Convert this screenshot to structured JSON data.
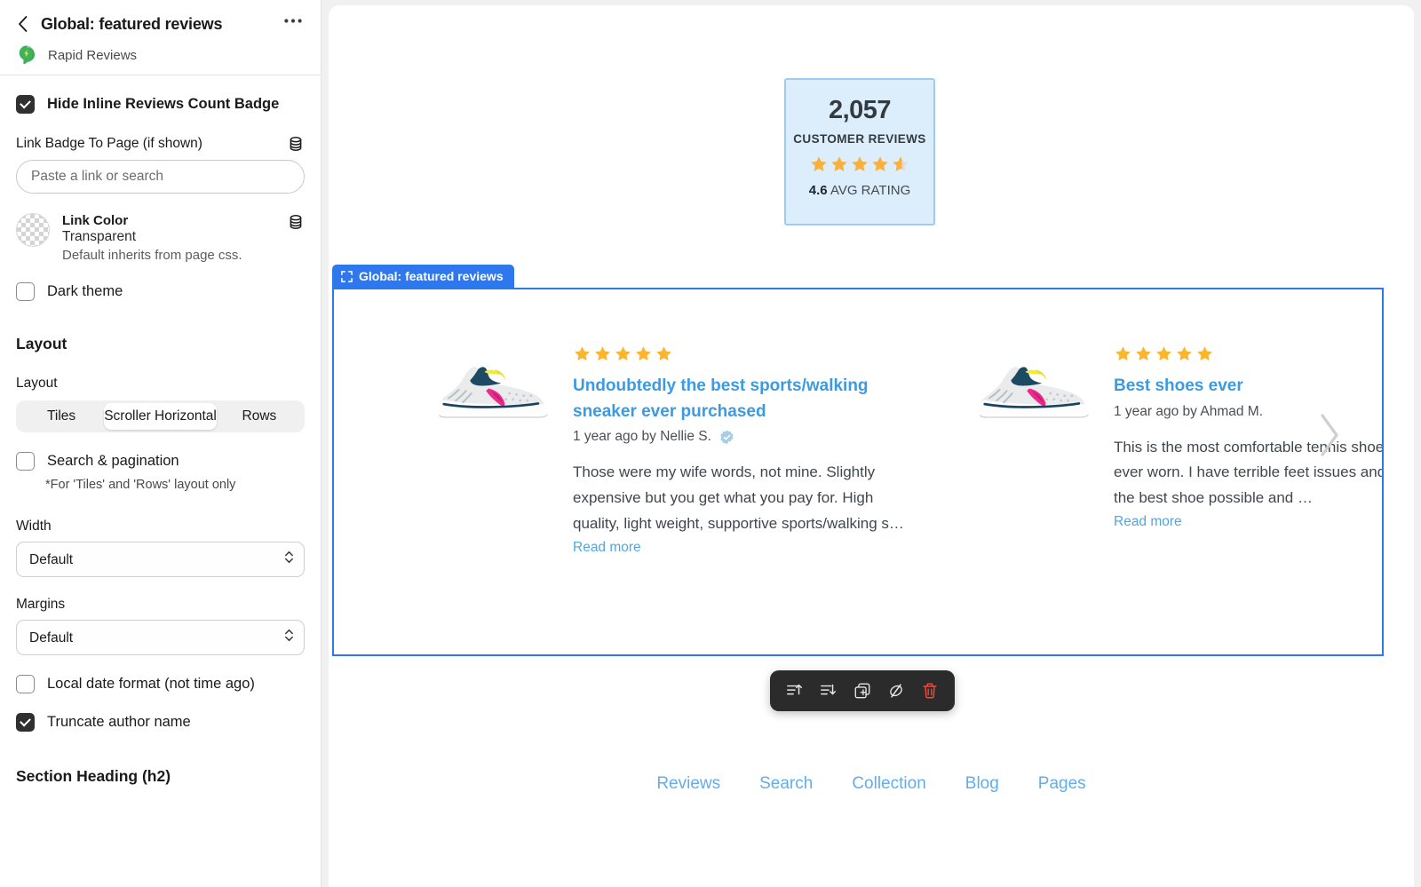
{
  "sidebar": {
    "back_icon": "chevron-left-icon",
    "title": "Global: featured reviews",
    "more_icon": "ellipsis-icon",
    "app_name": "Rapid Reviews",
    "hide_badge": {
      "label": "Hide Inline Reviews Count Badge",
      "checked": true
    },
    "link_badge": {
      "label": "Link Badge To Page (if shown)",
      "placeholder": "Paste a link or search",
      "value": "",
      "db_icon": "database-icon"
    },
    "link_color": {
      "name": "Link Color",
      "value": "Transparent",
      "hint": "Default inherits from page css.",
      "db_icon": "database-icon"
    },
    "dark_theme": {
      "label": "Dark theme",
      "checked": false
    },
    "layout_section_heading": "Layout",
    "layout_field_label": "Layout",
    "layout_options": [
      "Tiles",
      "Scroller Horizontal",
      "Rows"
    ],
    "layout_selected": "Scroller Horizontal",
    "search_pagination": {
      "label": "Search & pagination",
      "checked": false,
      "hint": "*For 'Tiles' and 'Rows' layout only"
    },
    "width": {
      "label": "Width",
      "value": "Default",
      "options": [
        "Default"
      ]
    },
    "margins": {
      "label": "Margins",
      "value": "Default",
      "options": [
        "Default"
      ]
    },
    "local_date": {
      "label": "Local date format (not time ago)",
      "checked": false
    },
    "truncate_author": {
      "label": "Truncate author name",
      "checked": true
    },
    "section_heading_h2": "Section Heading (h2)"
  },
  "canvas": {
    "summary_badge": {
      "count": "2,057",
      "caption": "CUSTOMER REVIEWS",
      "rating_value": "4.6",
      "rating_suffix": " AVG RATING",
      "stars": 4.6,
      "bg_color": "#dcedfb",
      "border_color": "#9ccdf0",
      "star_color": "#fbb03b"
    },
    "section_tab": {
      "label": "Global: featured reviews",
      "icon": "frame-select-icon",
      "color": "#2f77ec"
    },
    "reviews": [
      {
        "stars": 5,
        "title": "Undoubtedly the best sports/walking sneaker ever purchased",
        "meta": "1 year ago by Nellie S.",
        "verified": true,
        "body": "Those were my wife words, not mine. Slightly expensive but you get what you pay for. High quality, light weight, supportive sports/walking s…",
        "read_more": "Read more",
        "image_alt": "running-shoe"
      },
      {
        "stars": 5,
        "title": "Best shoes ever",
        "meta": "1 year ago by Ahmad M.",
        "verified": false,
        "body": "This is the most comfortable tennis shoe I have ever worn. I have terrible feet issues and this is the best shoe possible and …",
        "read_more": "Read more",
        "image_alt": "running-shoe"
      }
    ],
    "next_arrow_icon": "chevron-right-icon",
    "toolbar": [
      {
        "icon": "move-up-icon",
        "name": "move-up-button"
      },
      {
        "icon": "move-down-icon",
        "name": "move-down-button"
      },
      {
        "icon": "duplicate-icon",
        "name": "duplicate-button"
      },
      {
        "icon": "hide-eye-icon",
        "name": "hide-button"
      },
      {
        "icon": "trash-icon",
        "name": "delete-button"
      }
    ],
    "bottom_nav": [
      "Reviews",
      "Search",
      "Collection",
      "Blog",
      "Pages"
    ]
  }
}
